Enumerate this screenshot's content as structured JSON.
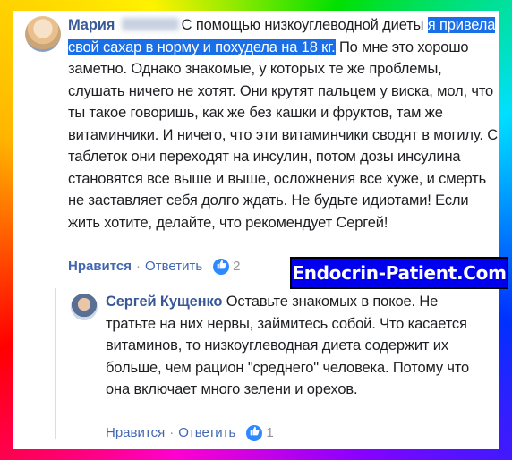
{
  "comment": {
    "author": "Мария",
    "text_before": "С помощью низкоуглеводной диеты ",
    "text_highlight": "я привела свой сахар в норму и похудела на 18 кг.",
    "text_after": " По мне это хорошо заметно. Однако знакомые, у которых те же проблемы, слушать ничего не хотят. Они крутят пальцем у виска, мол, что ты такое говоришь, как же без кашки и фруктов, там же витаминчики. И ничего, что эти витаминчики сводят в могилу. С таблеток они переходят на инсулин, потом дозы инсулина становятся все выше и выше, осложнения все хуже, и смерть не заставляет себя долго ждать. Не будьте идиотами! Если жить хотите, делайте, что рекомендует Сергей!",
    "like_label": "Нравится",
    "separator": "·",
    "reply_label": "Ответить",
    "like_count": "2"
  },
  "watermark": "Endocrin-Patient.Com",
  "reply": {
    "author": "Сергей Кущенко",
    "text": "Оставьте знакомых в покое. Не тратьте на них нервы, займитесь собой. Что касается витаминов, то низкоуглеводная диета содержит их больше, чем рацион \"среднего\" человека. Потому что она включает много зелени и орехов.",
    "like_label": "Нравится",
    "separator": "·",
    "reply_label": "Ответить",
    "like_count": "1"
  },
  "icons": {
    "like": "thumbs-up-icon"
  },
  "colors": {
    "author": "#385898",
    "highlight": "#1b6fe6",
    "like_badge": "#2e89ff",
    "watermark_bg": "#0000ee"
  }
}
